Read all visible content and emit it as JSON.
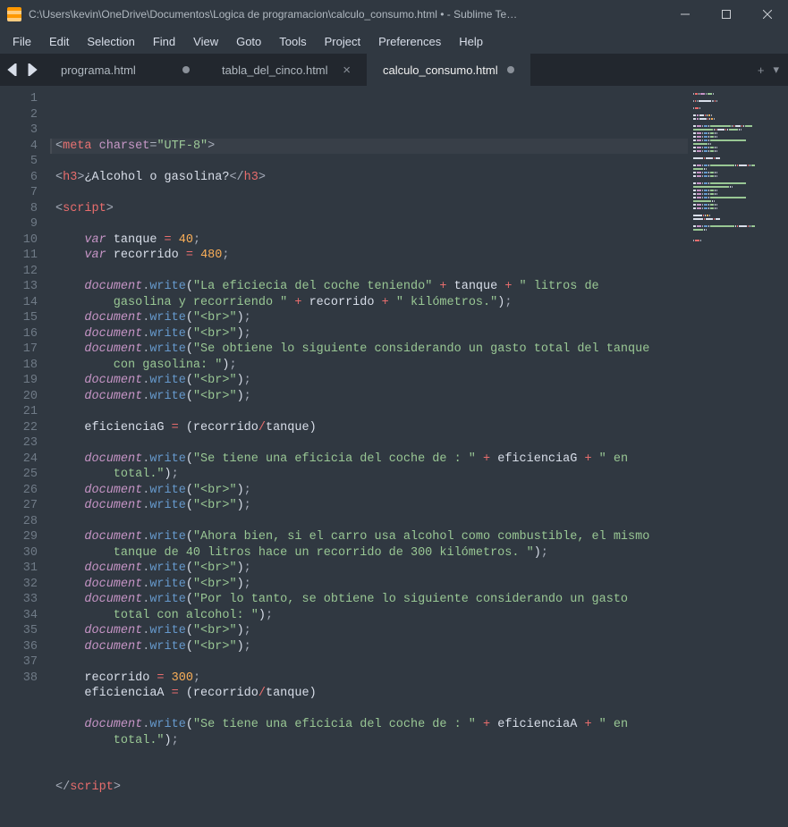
{
  "window": {
    "title": "C:\\Users\\kevin\\OneDrive\\Documentos\\Logica de programacion\\calculo_consumo.html • - Sublime Te…"
  },
  "menu": {
    "file": "File",
    "edit": "Edit",
    "selection": "Selection",
    "find": "Find",
    "view": "View",
    "goto": "Goto",
    "tools": "Tools",
    "project": "Project",
    "preferences": "Preferences",
    "help": "Help"
  },
  "tabs": [
    {
      "label": "programa.html",
      "active": false,
      "dirty": true,
      "close": false
    },
    {
      "label": "tabla_del_cinco.html",
      "active": false,
      "dirty": false,
      "close": true
    },
    {
      "label": "calculo_consumo.html",
      "active": true,
      "dirty": true,
      "close": false
    }
  ],
  "code": {
    "lines": [
      {
        "n": 1,
        "segs": [
          [
            "<",
            "c-gray"
          ],
          [
            "meta",
            "c-red"
          ],
          [
            " ",
            "c-white"
          ],
          [
            "charset",
            "c-purple"
          ],
          [
            "=",
            "c-gray"
          ],
          [
            "\"UTF-8\"",
            "c-green"
          ],
          [
            ">",
            "c-gray"
          ]
        ]
      },
      {
        "n": 2,
        "segs": []
      },
      {
        "n": 3,
        "segs": [
          [
            "<",
            "c-gray"
          ],
          [
            "h3",
            "c-red"
          ],
          [
            ">",
            "c-gray"
          ],
          [
            "¿Alcohol o gasolina?",
            "c-white"
          ],
          [
            "</",
            "c-gray"
          ],
          [
            "h3",
            "c-red"
          ],
          [
            ">",
            "c-gray"
          ]
        ]
      },
      {
        "n": 4,
        "segs": []
      },
      {
        "n": 5,
        "segs": [
          [
            "<",
            "c-gray"
          ],
          [
            "script",
            "c-red"
          ],
          [
            ">",
            "c-gray"
          ]
        ]
      },
      {
        "n": 6,
        "segs": []
      },
      {
        "n": 7,
        "segs": [
          [
            "    ",
            "c-white"
          ],
          [
            "var",
            "c-ital"
          ],
          [
            " tanque ",
            "c-white"
          ],
          [
            "=",
            "c-red"
          ],
          [
            " ",
            "c-white"
          ],
          [
            "40",
            "c-orange"
          ],
          [
            ";",
            "c-gray"
          ]
        ]
      },
      {
        "n": 8,
        "segs": [
          [
            "    ",
            "c-white"
          ],
          [
            "var",
            "c-ital"
          ],
          [
            " recorrido ",
            "c-white"
          ],
          [
            "=",
            "c-red"
          ],
          [
            " ",
            "c-white"
          ],
          [
            "480",
            "c-orange"
          ],
          [
            ";",
            "c-gray"
          ]
        ]
      },
      {
        "n": 9,
        "segs": []
      },
      {
        "n": 10,
        "segs": [
          [
            "    ",
            "c-white"
          ],
          [
            "document",
            "c-ital"
          ],
          [
            ".",
            "c-gray"
          ],
          [
            "write",
            "c-blue"
          ],
          [
            "(",
            "c-white"
          ],
          [
            "\"La eficiecia del coche teniendo\"",
            "c-green"
          ],
          [
            " ",
            "c-white"
          ],
          [
            "+",
            "c-red"
          ],
          [
            " tanque ",
            "c-white"
          ],
          [
            "+",
            "c-red"
          ],
          [
            " ",
            "c-white"
          ],
          [
            "\" litros de ",
            "c-green"
          ]
        ]
      },
      {
        "n": -1,
        "segs": [
          [
            "        gasolina y recorriendo \"",
            "c-green"
          ],
          [
            " ",
            "c-white"
          ],
          [
            "+",
            "c-red"
          ],
          [
            " recorrido ",
            "c-white"
          ],
          [
            "+",
            "c-red"
          ],
          [
            " ",
            "c-white"
          ],
          [
            "\" kilómetros.\"",
            "c-green"
          ],
          [
            ")",
            "c-white"
          ],
          [
            ";",
            "c-gray"
          ]
        ]
      },
      {
        "n": 11,
        "segs": [
          [
            "    ",
            "c-white"
          ],
          [
            "document",
            "c-ital"
          ],
          [
            ".",
            "c-gray"
          ],
          [
            "write",
            "c-blue"
          ],
          [
            "(",
            "c-white"
          ],
          [
            "\"<br>\"",
            "c-green"
          ],
          [
            ")",
            "c-white"
          ],
          [
            ";",
            "c-gray"
          ]
        ]
      },
      {
        "n": 12,
        "segs": [
          [
            "    ",
            "c-white"
          ],
          [
            "document",
            "c-ital"
          ],
          [
            ".",
            "c-gray"
          ],
          [
            "write",
            "c-blue"
          ],
          [
            "(",
            "c-white"
          ],
          [
            "\"<br>\"",
            "c-green"
          ],
          [
            ")",
            "c-white"
          ],
          [
            ";",
            "c-gray"
          ]
        ]
      },
      {
        "n": 13,
        "segs": [
          [
            "    ",
            "c-white"
          ],
          [
            "document",
            "c-ital"
          ],
          [
            ".",
            "c-gray"
          ],
          [
            "write",
            "c-blue"
          ],
          [
            "(",
            "c-white"
          ],
          [
            "\"Se obtiene lo siguiente considerando un gasto total del tanque ",
            "c-green"
          ]
        ]
      },
      {
        "n": -1,
        "segs": [
          [
            "        con gasolina: \"",
            "c-green"
          ],
          [
            ")",
            "c-white"
          ],
          [
            ";",
            "c-gray"
          ]
        ]
      },
      {
        "n": 14,
        "segs": [
          [
            "    ",
            "c-white"
          ],
          [
            "document",
            "c-ital"
          ],
          [
            ".",
            "c-gray"
          ],
          [
            "write",
            "c-blue"
          ],
          [
            "(",
            "c-white"
          ],
          [
            "\"<br>\"",
            "c-green"
          ],
          [
            ")",
            "c-white"
          ],
          [
            ";",
            "c-gray"
          ]
        ]
      },
      {
        "n": 15,
        "segs": [
          [
            "    ",
            "c-white"
          ],
          [
            "document",
            "c-ital"
          ],
          [
            ".",
            "c-gray"
          ],
          [
            "write",
            "c-blue"
          ],
          [
            "(",
            "c-white"
          ],
          [
            "\"<br>\"",
            "c-green"
          ],
          [
            ")",
            "c-white"
          ],
          [
            ";",
            "c-gray"
          ]
        ]
      },
      {
        "n": 16,
        "segs": []
      },
      {
        "n": 17,
        "segs": [
          [
            "    eficienciaG ",
            "c-white"
          ],
          [
            "=",
            "c-red"
          ],
          [
            " (recorrido",
            "c-white"
          ],
          [
            "/",
            "c-red"
          ],
          [
            "tanque)",
            "c-white"
          ]
        ]
      },
      {
        "n": 18,
        "segs": []
      },
      {
        "n": 19,
        "segs": [
          [
            "    ",
            "c-white"
          ],
          [
            "document",
            "c-ital"
          ],
          [
            ".",
            "c-gray"
          ],
          [
            "write",
            "c-blue"
          ],
          [
            "(",
            "c-white"
          ],
          [
            "\"Se tiene una eficicia del coche de : \"",
            "c-green"
          ],
          [
            " ",
            "c-white"
          ],
          [
            "+",
            "c-red"
          ],
          [
            " eficienciaG ",
            "c-white"
          ],
          [
            "+",
            "c-red"
          ],
          [
            " ",
            "c-white"
          ],
          [
            "\" en ",
            "c-green"
          ]
        ]
      },
      {
        "n": -1,
        "segs": [
          [
            "        total.\"",
            "c-green"
          ],
          [
            ")",
            "c-white"
          ],
          [
            ";",
            "c-gray"
          ]
        ]
      },
      {
        "n": 20,
        "segs": [
          [
            "    ",
            "c-white"
          ],
          [
            "document",
            "c-ital"
          ],
          [
            ".",
            "c-gray"
          ],
          [
            "write",
            "c-blue"
          ],
          [
            "(",
            "c-white"
          ],
          [
            "\"<br>\"",
            "c-green"
          ],
          [
            ")",
            "c-white"
          ],
          [
            ";",
            "c-gray"
          ]
        ]
      },
      {
        "n": 21,
        "segs": [
          [
            "    ",
            "c-white"
          ],
          [
            "document",
            "c-ital"
          ],
          [
            ".",
            "c-gray"
          ],
          [
            "write",
            "c-blue"
          ],
          [
            "(",
            "c-white"
          ],
          [
            "\"<br>\"",
            "c-green"
          ],
          [
            ")",
            "c-white"
          ],
          [
            ";",
            "c-gray"
          ]
        ]
      },
      {
        "n": 22,
        "segs": []
      },
      {
        "n": 23,
        "segs": [
          [
            "    ",
            "c-white"
          ],
          [
            "document",
            "c-ital"
          ],
          [
            ".",
            "c-gray"
          ],
          [
            "write",
            "c-blue"
          ],
          [
            "(",
            "c-white"
          ],
          [
            "\"Ahora bien, si el carro usa alcohol como combustible, el mismo ",
            "c-green"
          ]
        ]
      },
      {
        "n": -1,
        "segs": [
          [
            "        tanque de 40 litros hace un recorrido de 300 kilómetros. \"",
            "c-green"
          ],
          [
            ")",
            "c-white"
          ],
          [
            ";",
            "c-gray"
          ]
        ]
      },
      {
        "n": 24,
        "segs": [
          [
            "    ",
            "c-white"
          ],
          [
            "document",
            "c-ital"
          ],
          [
            ".",
            "c-gray"
          ],
          [
            "write",
            "c-blue"
          ],
          [
            "(",
            "c-white"
          ],
          [
            "\"<br>\"",
            "c-green"
          ],
          [
            ")",
            "c-white"
          ],
          [
            ";",
            "c-gray"
          ]
        ]
      },
      {
        "n": 25,
        "segs": [
          [
            "    ",
            "c-white"
          ],
          [
            "document",
            "c-ital"
          ],
          [
            ".",
            "c-gray"
          ],
          [
            "write",
            "c-blue"
          ],
          [
            "(",
            "c-white"
          ],
          [
            "\"<br>\"",
            "c-green"
          ],
          [
            ")",
            "c-white"
          ],
          [
            ";",
            "c-gray"
          ]
        ]
      },
      {
        "n": 26,
        "segs": [
          [
            "    ",
            "c-white"
          ],
          [
            "document",
            "c-ital"
          ],
          [
            ".",
            "c-gray"
          ],
          [
            "write",
            "c-blue"
          ],
          [
            "(",
            "c-white"
          ],
          [
            "\"Por lo tanto, se obtiene lo siguiente considerando un gasto ",
            "c-green"
          ]
        ]
      },
      {
        "n": -1,
        "segs": [
          [
            "        total con alcohol: \"",
            "c-green"
          ],
          [
            ")",
            "c-white"
          ],
          [
            ";",
            "c-gray"
          ]
        ]
      },
      {
        "n": 27,
        "segs": [
          [
            "    ",
            "c-white"
          ],
          [
            "document",
            "c-ital"
          ],
          [
            ".",
            "c-gray"
          ],
          [
            "write",
            "c-blue"
          ],
          [
            "(",
            "c-white"
          ],
          [
            "\"<br>\"",
            "c-green"
          ],
          [
            ")",
            "c-white"
          ],
          [
            ";",
            "c-gray"
          ]
        ]
      },
      {
        "n": 28,
        "segs": [
          [
            "    ",
            "c-white"
          ],
          [
            "document",
            "c-ital"
          ],
          [
            ".",
            "c-gray"
          ],
          [
            "write",
            "c-blue"
          ],
          [
            "(",
            "c-white"
          ],
          [
            "\"<br>\"",
            "c-green"
          ],
          [
            ")",
            "c-white"
          ],
          [
            ";",
            "c-gray"
          ]
        ]
      },
      {
        "n": 29,
        "segs": []
      },
      {
        "n": 30,
        "segs": [
          [
            "    recorrido ",
            "c-white"
          ],
          [
            "=",
            "c-red"
          ],
          [
            " ",
            "c-white"
          ],
          [
            "300",
            "c-orange"
          ],
          [
            ";",
            "c-gray"
          ]
        ]
      },
      {
        "n": 31,
        "segs": [
          [
            "    eficienciaA ",
            "c-white"
          ],
          [
            "=",
            "c-red"
          ],
          [
            " (recorrido",
            "c-white"
          ],
          [
            "/",
            "c-red"
          ],
          [
            "tanque)",
            "c-white"
          ]
        ]
      },
      {
        "n": 32,
        "segs": []
      },
      {
        "n": 33,
        "segs": [
          [
            "    ",
            "c-white"
          ],
          [
            "document",
            "c-ital"
          ],
          [
            ".",
            "c-gray"
          ],
          [
            "write",
            "c-blue"
          ],
          [
            "(",
            "c-white"
          ],
          [
            "\"Se tiene una eficicia del coche de : \"",
            "c-green"
          ],
          [
            " ",
            "c-white"
          ],
          [
            "+",
            "c-red"
          ],
          [
            " eficienciaA ",
            "c-white"
          ],
          [
            "+",
            "c-red"
          ],
          [
            " ",
            "c-white"
          ],
          [
            "\" en ",
            "c-green"
          ]
        ]
      },
      {
        "n": -1,
        "segs": [
          [
            "        total.\"",
            "c-green"
          ],
          [
            ")",
            "c-white"
          ],
          [
            ";",
            "c-gray"
          ]
        ]
      },
      {
        "n": 34,
        "segs": []
      },
      {
        "n": 35,
        "segs": []
      },
      {
        "n": 36,
        "segs": [
          [
            "</",
            "c-gray"
          ],
          [
            "script",
            "c-red"
          ],
          [
            ">",
            "c-gray"
          ]
        ]
      },
      {
        "n": 37,
        "segs": []
      },
      {
        "n": 38,
        "segs": []
      }
    ]
  }
}
